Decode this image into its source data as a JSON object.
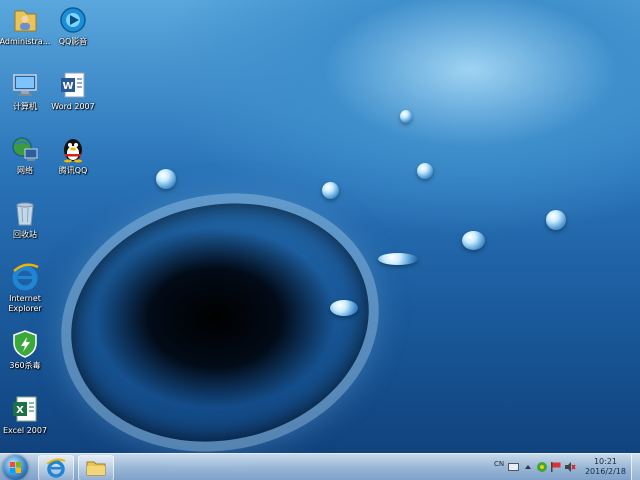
{
  "desktop_icons": [
    {
      "name": "administrator-folder",
      "label": "Administra...",
      "icon": "user-folder-icon"
    },
    {
      "name": "qq-player",
      "label": "QQ影音",
      "icon": "qq-player-icon"
    },
    {
      "name": "computer",
      "label": "计算机",
      "icon": "computer-icon"
    },
    {
      "name": "word-2007",
      "label": "Word 2007",
      "icon": "word-icon"
    },
    {
      "name": "network",
      "label": "网络",
      "icon": "network-icon"
    },
    {
      "name": "tencent-qq",
      "label": "腾讯QQ",
      "icon": "penguin-icon"
    },
    {
      "name": "recycle-bin",
      "label": "回收站",
      "icon": "recycle-bin-icon"
    },
    {
      "name": "internet-explorer",
      "label": "Internet Explorer",
      "icon": "ie-icon"
    },
    {
      "name": "360-antivirus",
      "label": "360杀毒",
      "icon": "shield-icon"
    },
    {
      "name": "excel-2007",
      "label": "Excel 2007",
      "icon": "excel-icon"
    }
  ],
  "taskbar": {
    "pinned": [
      {
        "name": "ie",
        "icon": "ie-icon"
      },
      {
        "name": "explorer",
        "icon": "folder-icon"
      }
    ],
    "tray": {
      "language": "CN",
      "icons": [
        "keyboard-icon",
        "chevron-up-icon",
        "security-icon",
        "flag-icon",
        "volume-muted-icon"
      ]
    },
    "clock": {
      "time": "10:21",
      "date": "2016/2/18"
    }
  },
  "colors": {
    "wallpaper_blue": "#2a74b8",
    "taskbar": "#a9c3de",
    "word_blue": "#2b5797",
    "excel_green": "#1e7145",
    "shield_green": "#3aa93a"
  }
}
